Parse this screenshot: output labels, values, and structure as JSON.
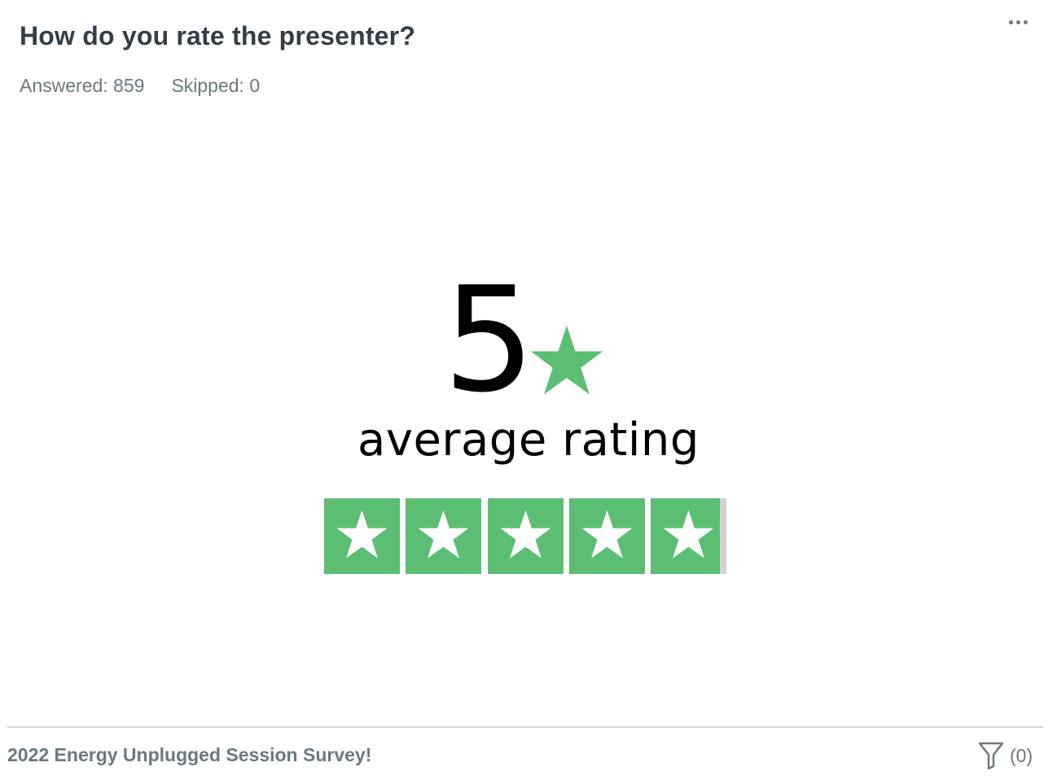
{
  "question": {
    "title": "How do you rate the presenter?",
    "answered_label": "Answered: 859",
    "skipped_label": "Skipped: 0"
  },
  "rating": {
    "value": "5",
    "label": "average rating",
    "max_stars": 5,
    "fill_fraction": 0.983,
    "star_color": "#5cbe73",
    "empty_color": "#d0d2d3"
  },
  "footer": {
    "survey_name": "2022 Energy Unplugged Session Survey!",
    "filter_count": "(0)"
  },
  "icons": {
    "menu": "more-horizontal-icon",
    "filter": "filter-funnel-icon",
    "star": "star-icon"
  }
}
